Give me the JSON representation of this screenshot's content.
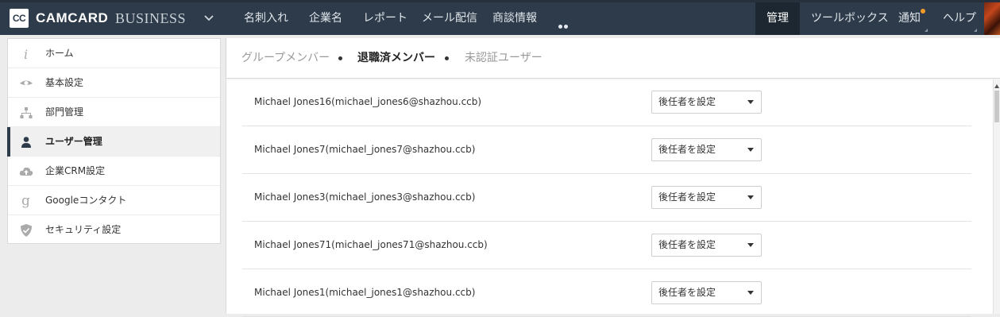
{
  "brand": {
    "logo": "CC",
    "name": "CAMCARD",
    "suffix": "BUSINESS"
  },
  "nav": {
    "items": [
      "名刺入れ",
      "企業名",
      "レポート",
      "メール配信",
      "商談情報"
    ],
    "more_icon": "ellipsis-icon",
    "right_items": [
      "管理",
      "ツールボックス",
      "通知",
      "ヘルプ"
    ],
    "active": "管理",
    "notify_color": "#f39c2b"
  },
  "sidebar": {
    "items": [
      {
        "label": "ホーム",
        "icon": "info-icon"
      },
      {
        "label": "基本設定",
        "icon": "eye-icon"
      },
      {
        "label": "部門管理",
        "icon": "org-chart-icon"
      },
      {
        "label": "ユーザー管理",
        "icon": "user-icon",
        "active": true
      },
      {
        "label": "企業CRM設定",
        "icon": "cloud-upload-icon"
      },
      {
        "label": "Googleコンタクト",
        "icon": "google-icon"
      },
      {
        "label": "セキュリティ設定",
        "icon": "shield-icon"
      }
    ]
  },
  "tabs": [
    "グループメンバー",
    "退職済メンバー",
    "未認証ユーザー"
  ],
  "active_tab": "退職済メンバー",
  "successor_placeholder": "後任者を設定",
  "users": [
    "Michael Jones16(michael_jones6@shazhou.ccb)",
    "Michael Jones7(michael_jones7@shazhou.ccb)",
    "Michael Jones3(michael_jones3@shazhou.ccb)",
    "Michael Jones71(michael_jones71@shazhou.ccb)",
    "Michael Jones1(michael_jones1@shazhou.ccb)"
  ],
  "colors": {
    "header_bg": "#2e3b4a",
    "active_nav_bg": "#1d2732"
  }
}
